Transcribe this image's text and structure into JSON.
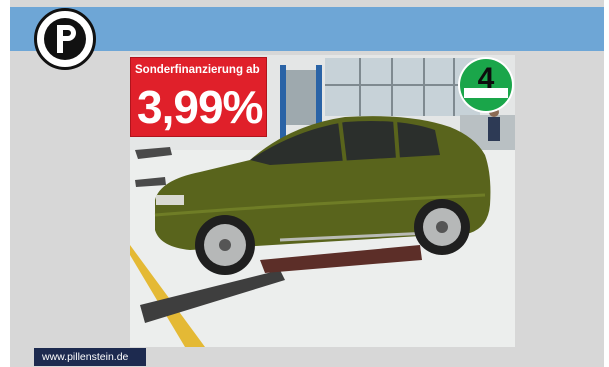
{
  "brand": {
    "logo_icon": "letter-p-logo-icon",
    "header_color": "#6ea6d6"
  },
  "promo": {
    "label": "Sonderfinanzierung ab",
    "rate": "3,99%",
    "color": "#e0202a"
  },
  "eco_badge": {
    "number": "4",
    "icon": "green-emission-sticker-icon",
    "color": "#1aa64a"
  },
  "photo": {
    "subject": "green-suv-photo"
  },
  "footer": {
    "url": "www.pillenstein.de"
  }
}
